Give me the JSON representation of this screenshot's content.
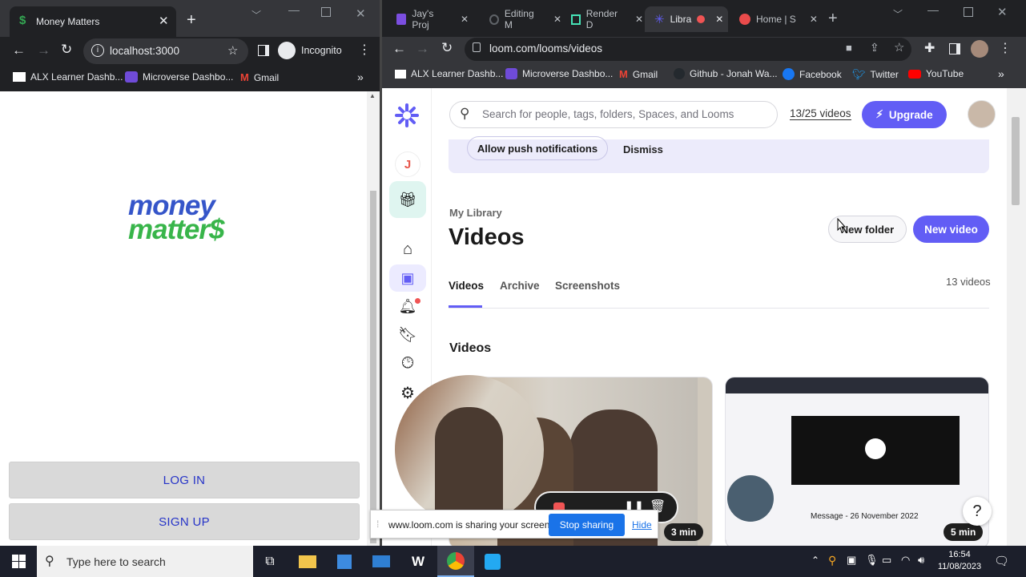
{
  "left_window": {
    "tab_title": "Money Matters",
    "address": "localhost:3000",
    "profile_label": "Incognito",
    "bookmarks": [
      {
        "label": "ALX Learner Dashb..."
      },
      {
        "label": "Microverse Dashbo..."
      },
      {
        "label": "Gmail"
      }
    ],
    "logo_line1": "money",
    "logo_line2": "matter$",
    "login_label": "LOG IN",
    "signup_label": "SIGN UP"
  },
  "right_window": {
    "tabs": [
      {
        "label": "Jay's Proj"
      },
      {
        "label": "Editing M"
      },
      {
        "label": "Render D"
      },
      {
        "label": "Libra"
      },
      {
        "label": "Home | S"
      }
    ],
    "address": "loom.com/looms/videos",
    "bookmarks": [
      {
        "label": "ALX Learner Dashb..."
      },
      {
        "label": "Microverse Dashbo..."
      },
      {
        "label": "Gmail"
      },
      {
        "label": "Github - Jonah Wa..."
      },
      {
        "label": "Facebook"
      },
      {
        "label": "Twitter"
      },
      {
        "label": "YouTube"
      }
    ]
  },
  "loom": {
    "sidebar_avatar_letter": "J",
    "search_placeholder": "Search for people, tags, folders, Spaces, and Looms",
    "video_count_link": "13/25 videos",
    "upgrade_label": "Upgrade",
    "banner": {
      "allow_label": "Allow push notifications",
      "dismiss_label": "Dismiss"
    },
    "breadcrumb": "My Library",
    "page_title": "Videos",
    "new_folder_label": "New folder",
    "new_video_label": "New video",
    "tabs": [
      {
        "label": "Videos"
      },
      {
        "label": "Archive"
      },
      {
        "label": "Screenshots"
      }
    ],
    "video_total": "13 videos",
    "section_title": "Videos",
    "card1_duration": "3 min",
    "card2_duration": "5 min",
    "card2_caption": "Message - 26 November 2022",
    "help_label": "?"
  },
  "sharing_bar": {
    "message": "www.loom.com is sharing your screen.",
    "stop_label": "Stop sharing",
    "hide_label": "Hide"
  },
  "taskbar": {
    "search_placeholder": "Type here to search",
    "time": "16:54",
    "date": "11/08/2023"
  },
  "colors": {
    "loom_purple": "#625df5",
    "link_blue": "#2634c8",
    "taskbar_bg": "#1c1f2b",
    "chrome_dark": "#202124"
  }
}
